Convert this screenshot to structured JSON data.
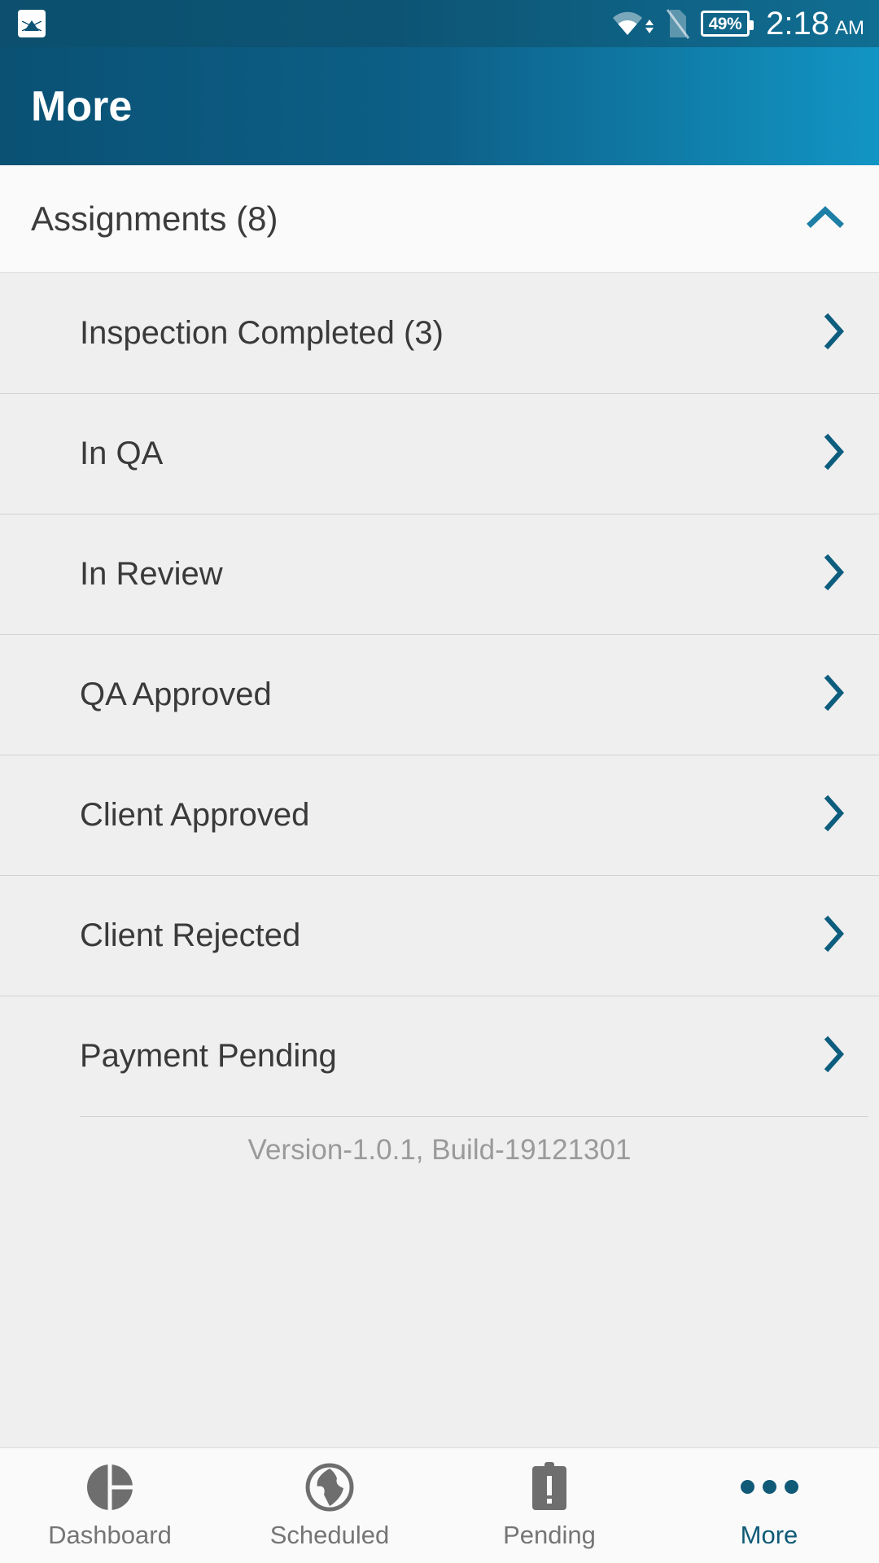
{
  "statusbar": {
    "photo_icon": "image-icon",
    "wifi_icon": "wifi-icon",
    "data_transfer_icon": "data-transfer-arrows-icon",
    "sim_off_icon": "sim-off-icon",
    "battery_icon": "battery-icon",
    "battery_level": "49%",
    "time": "2:18",
    "ampm": "AM"
  },
  "appbar": {
    "title": "More"
  },
  "group": {
    "title": "Assignments (8)",
    "collapse_icon": "chevron-up-icon",
    "expanded": true,
    "items": [
      {
        "label": "Inspection Completed (3)",
        "chevron": "chevron-right-icon"
      },
      {
        "label": "In QA",
        "chevron": "chevron-right-icon"
      },
      {
        "label": "In Review",
        "chevron": "chevron-right-icon"
      },
      {
        "label": "QA Approved",
        "chevron": "chevron-right-icon"
      },
      {
        "label": "Client Approved",
        "chevron": "chevron-right-icon"
      },
      {
        "label": "Client Rejected",
        "chevron": "chevron-right-icon"
      },
      {
        "label": "Payment Pending",
        "chevron": "chevron-right-icon"
      }
    ]
  },
  "footer": {
    "version_text": "Version-1.0.1, Build-19121301"
  },
  "bottomnav": {
    "items": [
      {
        "label": "Dashboard",
        "icon": "pie-chart-icon",
        "active": false
      },
      {
        "label": "Scheduled",
        "icon": "globe-icon",
        "active": false
      },
      {
        "label": "Pending",
        "icon": "clipboard-alert-icon",
        "active": false
      },
      {
        "label": "More",
        "icon": "three-dots-icon",
        "active": true
      }
    ]
  },
  "colors": {
    "appbar_start": "#0a5174",
    "appbar_end": "#1295c4",
    "accent": "#1d7fa5",
    "chevron": "#0d5d7e",
    "active_tab": "#105a78",
    "list_bg": "#efefef",
    "header_bg": "#fafafa",
    "version_text": "#9a9a9a"
  }
}
